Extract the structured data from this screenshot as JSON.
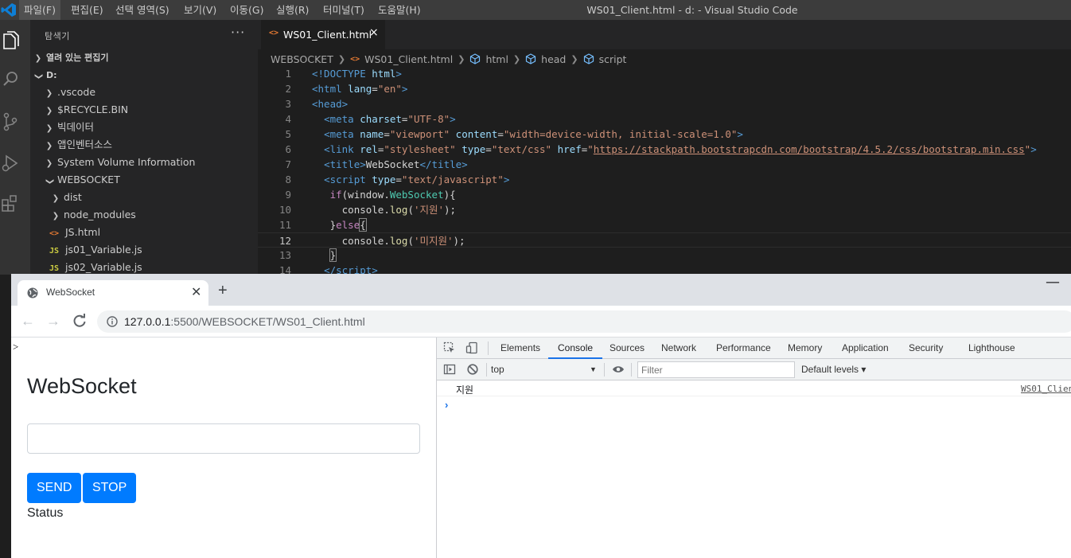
{
  "vscode": {
    "menu": [
      "파일(F)",
      "편집(E)",
      "선택 영역(S)",
      "보기(V)",
      "이동(G)",
      "실행(R)",
      "터미널(T)",
      "도움말(H)"
    ],
    "window_title": "WS01_Client.html - d: - Visual Studio Code",
    "sidebar": {
      "title": "탐색기",
      "more": "···",
      "open_editors": "열려 있는 편집기",
      "root": "D:",
      "items": [
        ".vscode",
        "$RECYCLE.BIN",
        "빅데이터",
        "앱인벤터소스",
        "System Volume Information",
        "WEBSOCKET"
      ],
      "websocket_children": [
        "dist",
        "node_modules",
        "JS.html",
        "js01_Variable.js",
        "js02_Variable.js"
      ],
      "file_badge_html": "<>",
      "file_badge_js": "JS"
    },
    "tab": {
      "label": "WS01_Client.html",
      "close": "×"
    },
    "breadcrumb": [
      "WEBSOCKET",
      "WS01_Client.html",
      "html",
      "head",
      "script"
    ],
    "line_numbers": [
      "1",
      "2",
      "3",
      "4",
      "5",
      "6",
      "7",
      "8",
      "9",
      "10",
      "11",
      "12",
      "13",
      "14"
    ]
  },
  "chrome": {
    "tab_title": "WebSocket",
    "tab_close": "✕",
    "new_tab": "+",
    "minimize": "—",
    "url_host": "127.0.0.1",
    "url_path": ":5500/WEBSOCKET/WS01_Client.html",
    "page": {
      "stray_text": ">",
      "heading": "WebSocket",
      "input_value": "",
      "send_label": "SEND",
      "stop_label": "STOP",
      "status": "Status"
    },
    "devtools": {
      "tabs": [
        "Elements",
        "Console",
        "Sources",
        "Network",
        "Performance",
        "Memory",
        "Application",
        "Security",
        "Lighthouse"
      ],
      "active_tab": "Console",
      "context": "top",
      "filter_placeholder": "Filter",
      "levels": "Default levels ▾",
      "log_message": "지원",
      "log_source": "WS01_Clien",
      "prompt": "›"
    }
  },
  "colors": {
    "vscode_bg": "#1e1e1e",
    "accent_blue": "#007bff",
    "devtools_active": "#1a73e8"
  }
}
